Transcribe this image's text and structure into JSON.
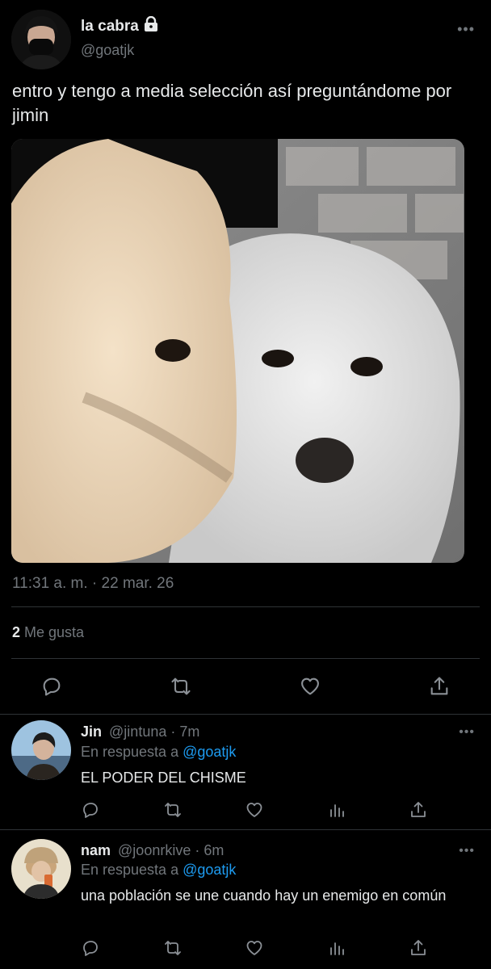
{
  "tweet": {
    "author_name": "la cabra",
    "author_handle": "@goatjk",
    "more": "•••",
    "text": "entro y tengo a media selección así preguntándome por jimin",
    "timestamp": "11:31 a. m. · 22 mar. 26",
    "likes_count": "2",
    "likes_label": "Me gusta",
    "lock_icon": "lock-icon",
    "actions": [
      "reply-icon",
      "retweet-icon",
      "like-icon",
      "share-icon"
    ]
  },
  "replies": [
    {
      "name": "Jin",
      "handle": "@jintuna",
      "time": "· 7m",
      "replying_prefix": "En respuesta a",
      "replying_to": "@goatjk",
      "text": "EL PODER DEL CHISME",
      "more": "•••"
    },
    {
      "name": "nam",
      "handle": "@joonrkive",
      "time": "· 6m",
      "replying_prefix": "En respuesta a",
      "replying_to": "@goatjk",
      "text": "una población se une cuando hay un enemigo en común",
      "more": "•••"
    }
  ],
  "colors": {
    "background": "#000000",
    "text": "#e7e9ea",
    "muted": "#71767b",
    "link": "#1d9bf0",
    "divider": "#2f3336"
  }
}
